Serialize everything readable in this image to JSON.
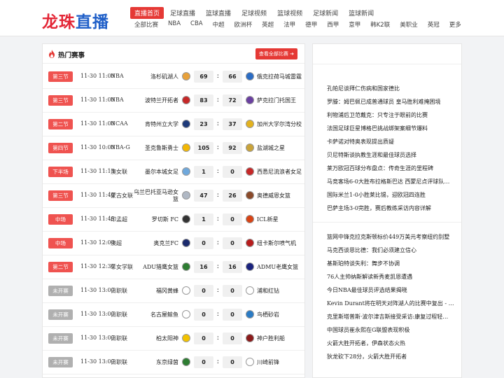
{
  "site": {
    "logo_part1": "龙珠",
    "logo_part2": "直播"
  },
  "nav_main": [
    {
      "label": "直播首页",
      "active": true
    },
    {
      "label": "足球直播"
    },
    {
      "label": "篮球直播"
    },
    {
      "label": "足球视频"
    },
    {
      "label": "篮球视频"
    },
    {
      "label": "足球新闻"
    },
    {
      "label": "篮球新闻"
    }
  ],
  "nav_sub": [
    "全部比赛",
    "NBA",
    "CBA",
    "中超",
    "欧洲杯",
    "英超",
    "法甲",
    "德甲",
    "西甲",
    "意甲",
    "韩K2联",
    "美职业",
    "英冠",
    "更多"
  ],
  "hot": {
    "title": "热门赛事",
    "view_all": "查看全部比赛 ➔"
  },
  "matches": [
    {
      "status": "第三节",
      "state": "live",
      "time": "11-30 11:00",
      "league": "NBA",
      "home": "洛杉矶湖人",
      "home_score": "69",
      "away_score": "66",
      "away": "俄克拉荷马城雷霆",
      "home_color": "#e8a13a",
      "away_color": "#2b6cc4"
    },
    {
      "status": "第三节",
      "state": "live",
      "time": "11-30 11:00",
      "league": "NBA",
      "home": "波特兰开拓者",
      "home_score": "83",
      "away_score": "72",
      "away": "萨克拉门托国王",
      "home_color": "#c62828",
      "away_color": "#6a3fa0"
    },
    {
      "status": "第二节",
      "state": "live",
      "time": "11-30 11:00",
      "league": "NCAA",
      "home": "肯特州立大学",
      "home_score": "23",
      "away_score": "37",
      "away": "加州大学尔湾分校",
      "home_color": "#1e3a7a",
      "away_color": "#e3b21f"
    },
    {
      "status": "第四节",
      "state": "live",
      "time": "11-30 10:00",
      "league": "NBA-G",
      "home": "圣克鲁斯勇士",
      "home_score": "105",
      "away_score": "92",
      "away": "盐湖城之星",
      "home_color": "#f2b705",
      "away_color": "#c9a33a"
    },
    {
      "status": "下半场",
      "state": "live",
      "time": "11-30 11:15",
      "league": "澳女联",
      "home": "墨尔本城女足",
      "home_score": "1",
      "away_score": "0",
      "away": "西悉尼流浪者女足",
      "home_color": "#6fa8dc",
      "away_color": "#c62828"
    },
    {
      "status": "第三节",
      "state": "live",
      "time": "11-30 11:40",
      "league": "蒙古女联",
      "home": "乌兰巴托亚马逊女篮",
      "home_score": "47",
      "away_score": "26",
      "away": "奥德威恩女篮",
      "home_color": "#b0b8c4",
      "away_color": "#8a4a2a"
    },
    {
      "status": "中场",
      "state": "live",
      "time": "11-30 11:45",
      "league": "印孟超",
      "home": "罗切斯 FC",
      "home_score": "1",
      "away_score": "0",
      "away": "ICL新星",
      "home_color": "#333333",
      "away_color": "#d84315"
    },
    {
      "status": "中场",
      "state": "live",
      "time": "11-30 12:00",
      "league": "澳超",
      "home": "奥克兰FC",
      "home_score": "0",
      "away_score": "0",
      "away": "纽卡斯尔喷气机",
      "home_color": "#1a2a6c",
      "away_color": "#b71c1c"
    },
    {
      "status": "第二节",
      "state": "live",
      "time": "11-30 12:30",
      "league": "菲女学联",
      "home": "ADU猎鹰女篮",
      "home_score": "16",
      "away_score": "16",
      "away": "ADMU老鹰女篮",
      "home_color": "#2e7d32",
      "away_color": "#1a237e"
    },
    {
      "status": "未开赛",
      "state": "pending",
      "time": "11-30 13:00",
      "league": "日职联",
      "home": "福冈黄蜂",
      "home_score": "0",
      "away_score": "0",
      "away": "浦和红钻",
      "home_color": "#ffffff",
      "away_color": "#ffffff"
    },
    {
      "status": "未开赛",
      "state": "pending",
      "time": "11-30 13:00",
      "league": "日职联",
      "home": "名古屋鲸鱼",
      "home_score": "0",
      "away_score": "0",
      "away": "鸟栖砂岩",
      "home_color": "#ffffff",
      "away_color": "#2b7bc4"
    },
    {
      "status": "未开赛",
      "state": "pending",
      "time": "11-30 13:00",
      "league": "日职联",
      "home": "柏太阳神",
      "home_score": "0",
      "away_score": "0",
      "away": "神户胜利船",
      "home_color": "#f2c200",
      "away_color": "#8b1a1a"
    },
    {
      "status": "未开赛",
      "state": "pending",
      "time": "11-30 13:00",
      "league": "日职联",
      "home": "东京绿茵",
      "home_score": "0",
      "away_score": "0",
      "away": "川崎前锋",
      "home_color": "#2e7d32",
      "away_color": "#ffffff"
    }
  ],
  "news_group1": [
    "孔帕尼谈拜仁伤病和国家德比",
    "罗滕：姆巴佩已成普通球员 皇马胜利难掩困境",
    "利物浦后卫范戴克：只专注于眼前的比赛",
    "法国足球巨星博格巴挑战绑架案细节爆料",
    "卡萨诺对特奥表现提出质疑",
    "贝尼特斯谈执教生涯和最佳球员选择",
    "莱万欧冠百球分布盘点：传奇生涯的里程碑",
    "马竞客场6-0大胜布拉格斯巴达 西蒙尼点评球队…",
    "国际米兰1-0小胜莱比锡，迎欧冠四连胜",
    "巴萨主场3-0完胜，赛后教练采访内容详解"
  ],
  "news_group2": [
    "篮网中锋克拉克斯顿标价449万美元考察纽约别墅",
    "马克西谈恩比德：我们必须建立信心",
    "基斯珀特谈失利：舞步不协调",
    "76人主帅纳斯解读新秀麦凯恩遭遇",
    "今日NBA最佳球员评选结果揭晓",
    "Kevin Durant将在明天对阵湖人的比赛中复出 - 美…",
    "克里斯塔普斯·波尔津吉斯接受采访:康复过程轻…",
    "中国球员崔永熙在G联盟表现积极",
    "火箭大胜开拓者，伊森状态火热",
    "狄龙砍下28分，火箭大胜开拓者"
  ]
}
